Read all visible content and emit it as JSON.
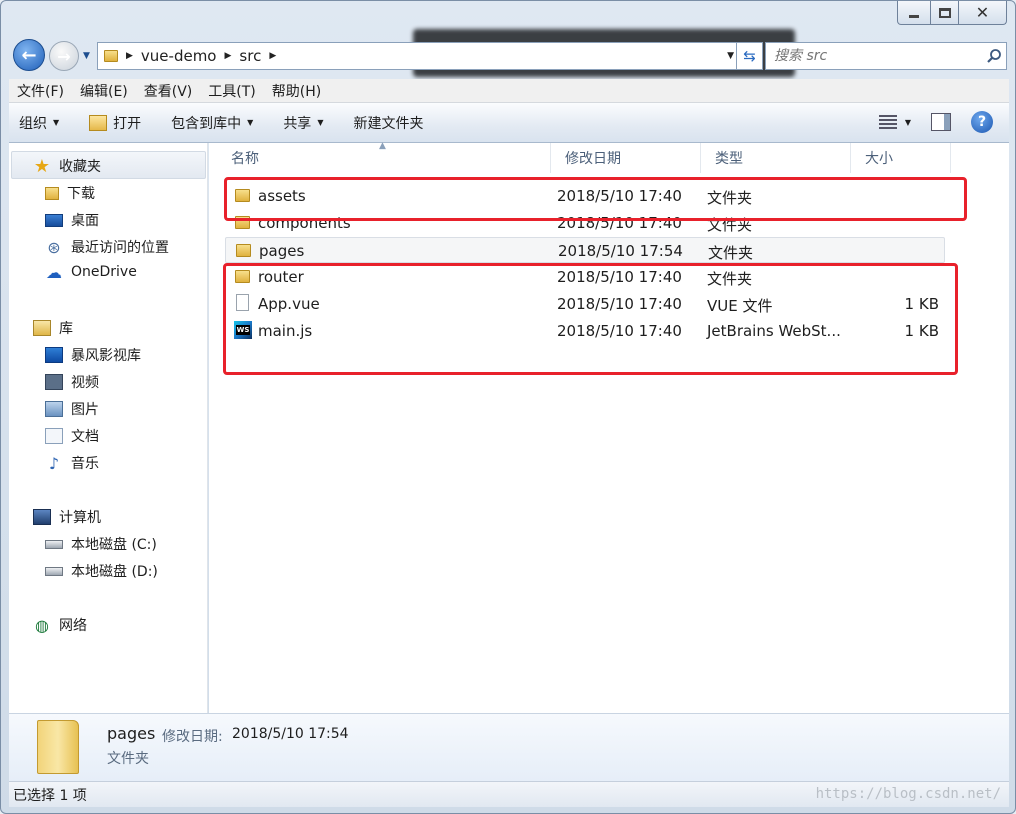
{
  "window": {
    "min_glyph": "",
    "close_glyph": "✕"
  },
  "nav": {
    "back_glyph": "←",
    "fwd_glyph": "→",
    "dropdown_glyph": "▼"
  },
  "address": {
    "crumbs": [
      "vue-demo",
      "src"
    ],
    "sep_glyph": "▶",
    "dropdown_glyph": "▼",
    "refresh_glyph": "⇆"
  },
  "search": {
    "placeholder": "搜索 src"
  },
  "menu": [
    "文件(F)",
    "编辑(E)",
    "查看(V)",
    "工具(T)",
    "帮助(H)"
  ],
  "commands": {
    "organize": "组织",
    "open": "打开",
    "include_library": "包含到库中",
    "share": "共享",
    "new_folder": "新建文件夹",
    "dd_glyph": "▼"
  },
  "navpane": {
    "favorites": "收藏夹",
    "downloads": "下载",
    "desktop": "桌面",
    "recent": "最近访问的位置",
    "onedrive": "OneDrive",
    "libraries": "库",
    "baofeng": "暴风影视库",
    "videos": "视频",
    "pictures": "图片",
    "documents": "文档",
    "music": "音乐",
    "computer": "计算机",
    "disk_c": "本地磁盘 (C:)",
    "disk_d": "本地磁盘 (D:)",
    "network": "网络",
    "star_glyph": "★",
    "cloud_glyph": "☁",
    "music_glyph": "♪",
    "recent_glyph": "⊛",
    "net_glyph": "◍"
  },
  "columns": {
    "name": "名称",
    "date": "修改日期",
    "type": "类型",
    "size": "大小",
    "sort_glyph": "▲"
  },
  "files": [
    {
      "name": "assets",
      "date": "2018/5/10 17:40",
      "type": "文件夹",
      "size": ""
    },
    {
      "name": "components",
      "date": "2018/5/10 17:40",
      "type": "文件夹",
      "size": ""
    },
    {
      "name": "pages",
      "date": "2018/5/10 17:54",
      "type": "文件夹",
      "size": ""
    },
    {
      "name": "router",
      "date": "2018/5/10 17:40",
      "type": "文件夹",
      "size": ""
    },
    {
      "name": "App.vue",
      "date": "2018/5/10 17:40",
      "type": "VUE 文件",
      "size": "1 KB"
    },
    {
      "name": "main.js",
      "date": "2018/5/10 17:40",
      "type": "JetBrains WebSt...",
      "size": "1 KB"
    }
  ],
  "ws_badge": "WS",
  "details": {
    "name": "pages",
    "date_label": "修改日期:",
    "date": "2018/5/10 17:54",
    "type": "文件夹"
  },
  "status": {
    "text": "已选择 1 项"
  },
  "help_glyph": "?",
  "colors": {
    "accent": "#1f5fb8",
    "highlight_box": "#e8212b",
    "folder": "#e0b23e"
  }
}
